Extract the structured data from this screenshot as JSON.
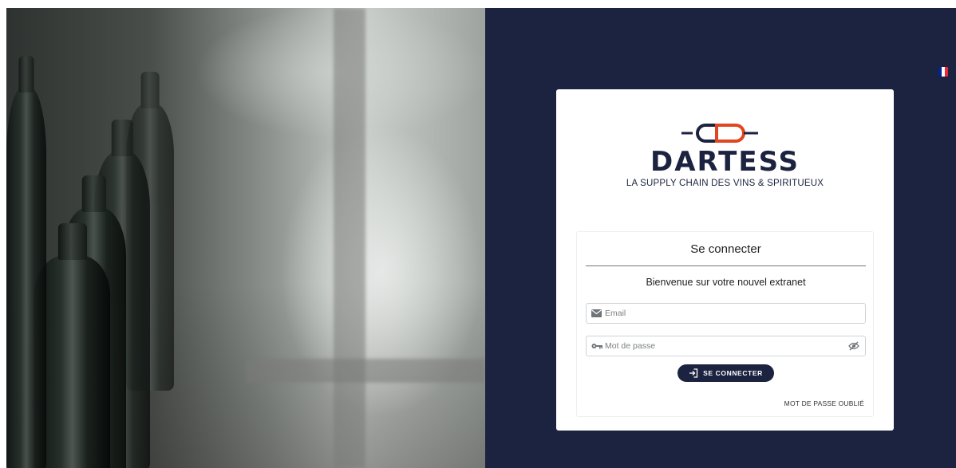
{
  "brand": {
    "name": "DARTESS",
    "tagline": "LA SUPPLY CHAIN DES VINS & SPIRITUEUX",
    "logo_icon": "chain-link-icon",
    "colors": {
      "navy": "#1c2340",
      "accent": "#e0461f"
    }
  },
  "language": {
    "flag": "flag-fr-icon",
    "colors": [
      "#002395",
      "#ffffff",
      "#ed2939"
    ]
  },
  "login": {
    "title": "Se connecter",
    "subtitle": "Bienvenue sur votre nouvel extranet",
    "email": {
      "placeholder": "Email",
      "icon": "envelope-icon",
      "value": ""
    },
    "password": {
      "placeholder": "Mot de passe",
      "icon": "key-icon",
      "toggle_icon": "eye-slash-icon",
      "value": ""
    },
    "submit_label": "SE CONNECTER",
    "submit_icon": "login-arrow-icon",
    "forgot_label": "MOT DE PASSE OUBLIÉ"
  }
}
